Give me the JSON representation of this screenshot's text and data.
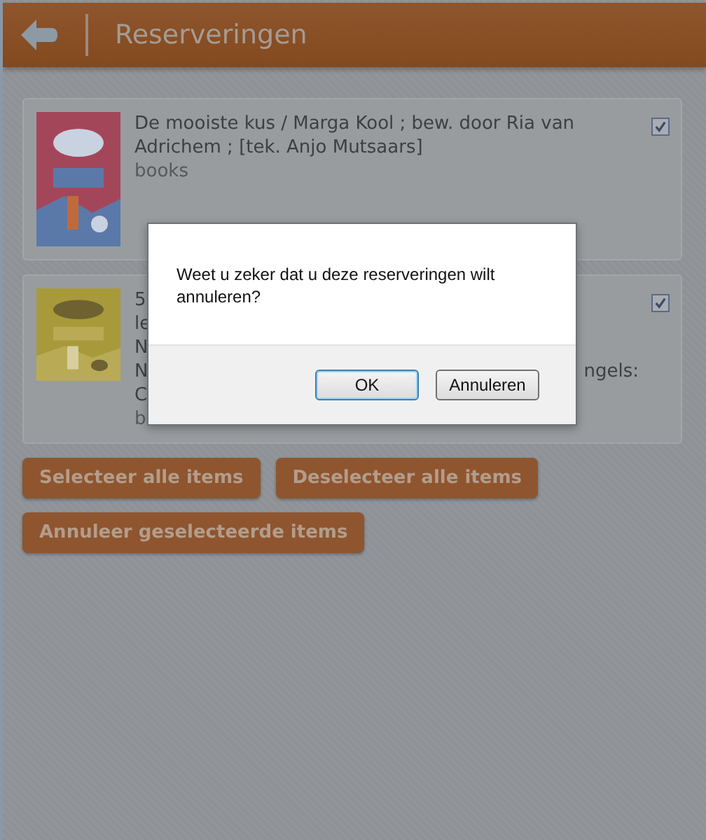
{
  "header": {
    "title": "Reserveringen"
  },
  "items": [
    {
      "cover": {
        "kind": "picture"
      },
      "lines": [
        {
          "start": "De mooiste kus / Marga Kool ; bew. door Ria van"
        },
        {
          "start": "Adrichem ; [tek. Anjo Mutsaars]"
        }
      ],
      "category": "books",
      "checked": true
    },
    {
      "cover": {
        "kind": "picture"
      },
      "lines": [
        {
          "start": "5"
        },
        {
          "start": "le"
        },
        {
          "start": "N"
        },
        {
          "start": "N",
          "end": "ngels:"
        },
        {
          "start": "C"
        }
      ],
      "category": "b",
      "checked": true
    }
  ],
  "buttons": [
    "Selecteer alle items",
    "Deselecteer alle items",
    "Annuleer geselecteerde items"
  ],
  "dialog": {
    "message": "Weet u zeker dat u deze reserveringen wilt annuleren?",
    "buttons": [
      {
        "label": "OK",
        "selected": true
      },
      {
        "label": "Annuleren",
        "selected": false
      }
    ]
  }
}
